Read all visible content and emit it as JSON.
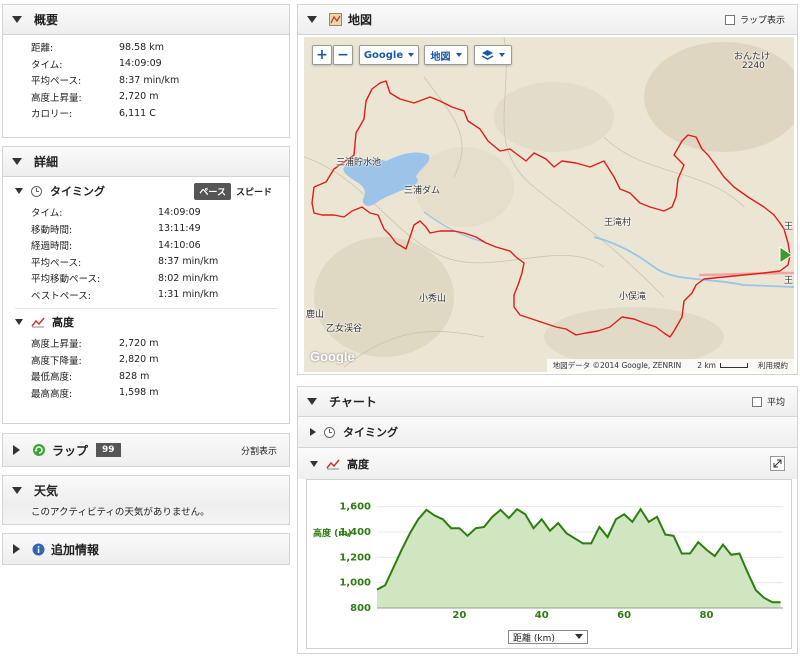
{
  "summary": {
    "title": "概要",
    "rows": [
      {
        "label": "距離:",
        "value": "98.58 km"
      },
      {
        "label": "タイム:",
        "value": "14:09:09"
      },
      {
        "label": "平均ペース:",
        "value": "8:37 min/km"
      },
      {
        "label": "高度上昇量:",
        "value": "2,720 m"
      },
      {
        "label": "カロリー:",
        "value": "6,111 C"
      }
    ]
  },
  "details": {
    "title": "詳細",
    "timing": {
      "title": "タイミング",
      "toggle_pace": "ペース",
      "toggle_speed": "スピード",
      "rows": [
        {
          "label": "タイム:",
          "value": "14:09:09"
        },
        {
          "label": "移動時間:",
          "value": "13:11:49"
        },
        {
          "label": "経過時間:",
          "value": "14:10:06"
        },
        {
          "label": "平均ペース:",
          "value": "8:37 min/km"
        },
        {
          "label": "平均移動ペース:",
          "value": "8:02 min/km"
        },
        {
          "label": "ベストペース:",
          "value": "1:31 min/km"
        }
      ]
    },
    "elevation": {
      "title": "高度",
      "rows": [
        {
          "label": "高度上昇量:",
          "value": "2,720 m"
        },
        {
          "label": "高度下降量:",
          "value": "2,820 m"
        },
        {
          "label": "最低高度:",
          "value": "828 m"
        },
        {
          "label": "最高高度:",
          "value": "1,598 m"
        }
      ]
    }
  },
  "laps": {
    "title": "ラップ",
    "count": "99",
    "split_label": "分割表示"
  },
  "weather": {
    "title": "天気",
    "message": "このアクティビティの天気がありません。"
  },
  "extra": {
    "title": "追加情報"
  },
  "map": {
    "title": "地図",
    "laps_checkbox": "ラップ表示",
    "zoom_in": "+",
    "zoom_out": "−",
    "provider_button": "Google",
    "type_button": "地図",
    "labels": {
      "ontake": "おんたけ",
      "ontake_elev": "2240",
      "reservoir": "三浦貯水池",
      "dam": "三浦ダム",
      "village": "王滝村",
      "kohidaki": "小俣滝",
      "koshuzan": "小秀山",
      "otomekei": "乙女渓谷",
      "shikayama": "鹿山",
      "edge_o1": "王",
      "edge_o2": "王"
    },
    "footer_data": "地図データ ©2014 Google, ZENRIN",
    "footer_scale": "2 km",
    "footer_terms": "利用規約",
    "watermark": "Google"
  },
  "chart_panel": {
    "title": "チャート",
    "average_checkbox": "平均",
    "timing_row": "タイミング",
    "elevation_row": "高度",
    "x_select": "距離 (km)"
  },
  "chart_data": {
    "type": "area",
    "ylabel": "高度 (m)",
    "xlabel": "距離 (km)",
    "xlim": [
      0,
      98.58
    ],
    "ylim": [
      800,
      1700
    ],
    "xticks": [
      20,
      40,
      60,
      80
    ],
    "yticks": [
      800,
      1000,
      1200,
      1400,
      1600
    ],
    "ytick_labels": [
      "800",
      "1,000",
      "1,200",
      "1,400",
      "1,600"
    ],
    "color": "#2e7d12",
    "fill": "#cfe6c0",
    "x": [
      0,
      2,
      4,
      6,
      8,
      10,
      12,
      14,
      16,
      18,
      20,
      22,
      24,
      26,
      28,
      30,
      32,
      34,
      36,
      38,
      40,
      42,
      44,
      46,
      48,
      50,
      52,
      54,
      56,
      58,
      60,
      62,
      64,
      66,
      68,
      70,
      72,
      74,
      76,
      78,
      80,
      82,
      84,
      86,
      88,
      90,
      92,
      94,
      96,
      98
    ],
    "y": [
      945,
      980,
      1120,
      1260,
      1390,
      1500,
      1575,
      1530,
      1500,
      1430,
      1430,
      1370,
      1430,
      1440,
      1520,
      1575,
      1510,
      1580,
      1540,
      1430,
      1500,
      1410,
      1470,
      1390,
      1350,
      1310,
      1310,
      1440,
      1360,
      1500,
      1540,
      1480,
      1580,
      1480,
      1520,
      1380,
      1370,
      1230,
      1230,
      1320,
      1260,
      1210,
      1300,
      1220,
      1230,
      1080,
      940,
      880,
      845,
      845
    ]
  }
}
